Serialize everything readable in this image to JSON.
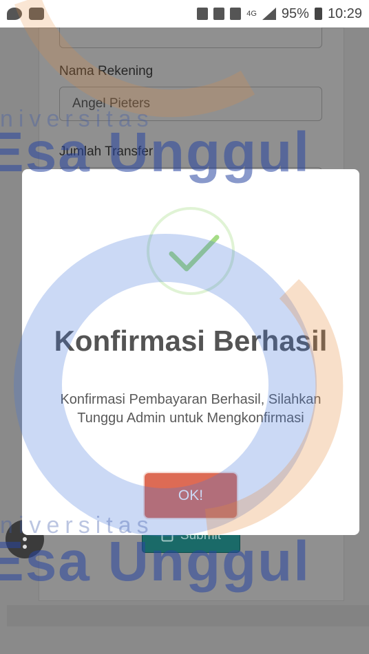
{
  "status_bar": {
    "network": "4G",
    "battery": "95%",
    "time": "10:29"
  },
  "form": {
    "account_name_label": "Nama Rekening",
    "account_name_value": "Angel Pieters",
    "transfer_amount_label": "Jumlah Transfer",
    "submit_label": "Submit"
  },
  "modal": {
    "title": "Konfirmasi Berhasil",
    "message": "Konfirmasi Pembayaran Berhasil, Silahkan Tunggu Admin untuk Mengkonfirmasi",
    "ok_label": "OK!"
  },
  "watermark": {
    "small": "niversitas",
    "large": "Esa Unggul"
  },
  "colors": {
    "ok_button": "#dd6b55",
    "success_check": "#a5dc86",
    "submit_button": "#1a6a68"
  }
}
